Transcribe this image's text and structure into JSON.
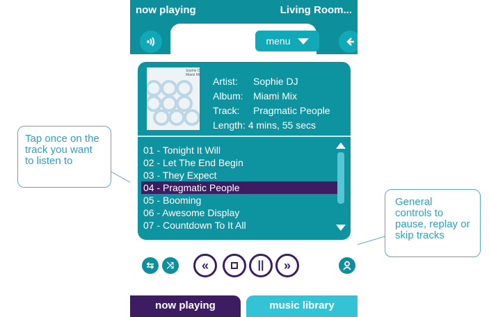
{
  "header": {
    "title": "now playing",
    "location": "Living Room..."
  },
  "toolbar": {
    "speaker_icon": "speaker-icon",
    "menu_label": "menu",
    "back_icon": "back-arrow-icon"
  },
  "now_playing": {
    "album_art_text": "Sophie DJ\nMiami Mix",
    "artist_label": "Artist:",
    "artist": "Sophie DJ",
    "album_label": "Album:",
    "album": "Miami Mix",
    "track_label": "Track:",
    "track": "Pragmatic People",
    "length_label": "Length:",
    "length": "4 mins, 55 secs"
  },
  "tracklist": [
    {
      "label": "01 - Tonight It Will",
      "selected": false
    },
    {
      "label": "02 - Let The End Begin",
      "selected": false
    },
    {
      "label": "03 - They Expect",
      "selected": false
    },
    {
      "label": "04 - Pragmatic People",
      "selected": true
    },
    {
      "label": "05 - Booming",
      "selected": false
    },
    {
      "label": "06 - Awesome Display",
      "selected": false
    },
    {
      "label": "07 - Countdown To It All",
      "selected": false
    }
  ],
  "controls": {
    "repeat_icon": "repeat-icon",
    "shuffle_icon": "shuffle-icon",
    "rewind_icon": "rewind-icon",
    "stop_icon": "stop-icon",
    "pause_icon": "pause-icon",
    "forward_icon": "fast-forward-icon",
    "user_icon": "user-icon"
  },
  "tabs": {
    "now_playing": "now playing",
    "music_library": "music library"
  },
  "callouts": {
    "left": "Tap once on the track you want to listen to",
    "right": "General controls to pause, replay or skip tracks"
  },
  "colors": {
    "teal": "#0e8f9c",
    "purple": "#3d1c63",
    "light_teal": "#33c3d6",
    "callout_text": "#2ba0c8"
  }
}
